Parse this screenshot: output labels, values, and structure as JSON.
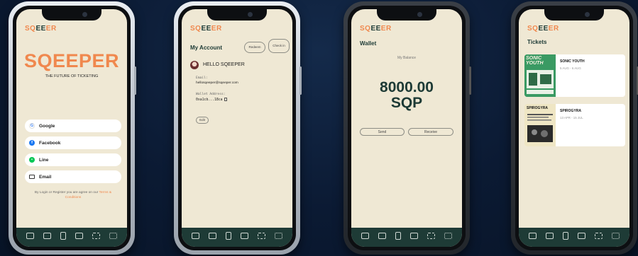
{
  "brand": {
    "logo_left": "SQ",
    "logo_mid": "EE",
    "logo_right": "ER",
    "name": "SQEEPER",
    "accent_color": "#f0884e",
    "dark_color": "#1e3b36",
    "background_color": "#efe8d4"
  },
  "login_screen": {
    "title": "SQEEPER",
    "tagline": "THE FUTURE OF TICKETING",
    "buttons": [
      {
        "label": "Google",
        "icon": "google-icon"
      },
      {
        "label": "Facebook",
        "icon": "facebook-icon"
      },
      {
        "label": "Line",
        "icon": "line-icon"
      },
      {
        "label": "Email",
        "icon": "email-icon"
      }
    ],
    "terms_prefix": "By Login or Register you are agree on our ",
    "terms_link": "Terms & Conditions"
  },
  "account_screen": {
    "title": "My Account",
    "redeem_label": "Redeem",
    "checkin_label": "Check in",
    "greeting": "HELLO SQEEPER",
    "email_label": "Email:",
    "email_value": "hellosqeeper@sqeeper.com",
    "wallet_label": "Wallet Address:",
    "wallet_value": "0xa1cb...18ca",
    "edit_label": "Edit"
  },
  "wallet_screen": {
    "title": "Wallet",
    "balance_label": "My Balance",
    "balance_amount": "8000.00",
    "balance_unit": "SQP",
    "send_label": "Send",
    "receive_label": "Receive"
  },
  "tickets_screen": {
    "title": "Tickets",
    "items": [
      {
        "name": "SONIC YOUTH",
        "date": "5 AUG - 6 AUG",
        "poster_text": "SONIC YOUTH"
      },
      {
        "name": "SPIROGYRA",
        "date": "13 APR - 15 JUL",
        "poster_text": "SPIROGYRA"
      }
    ]
  },
  "tabbar": {
    "icons": [
      "wallet-icon",
      "ticket-icon",
      "phone-icon",
      "ar-icon",
      "scan-icon",
      "qr-icon"
    ]
  }
}
